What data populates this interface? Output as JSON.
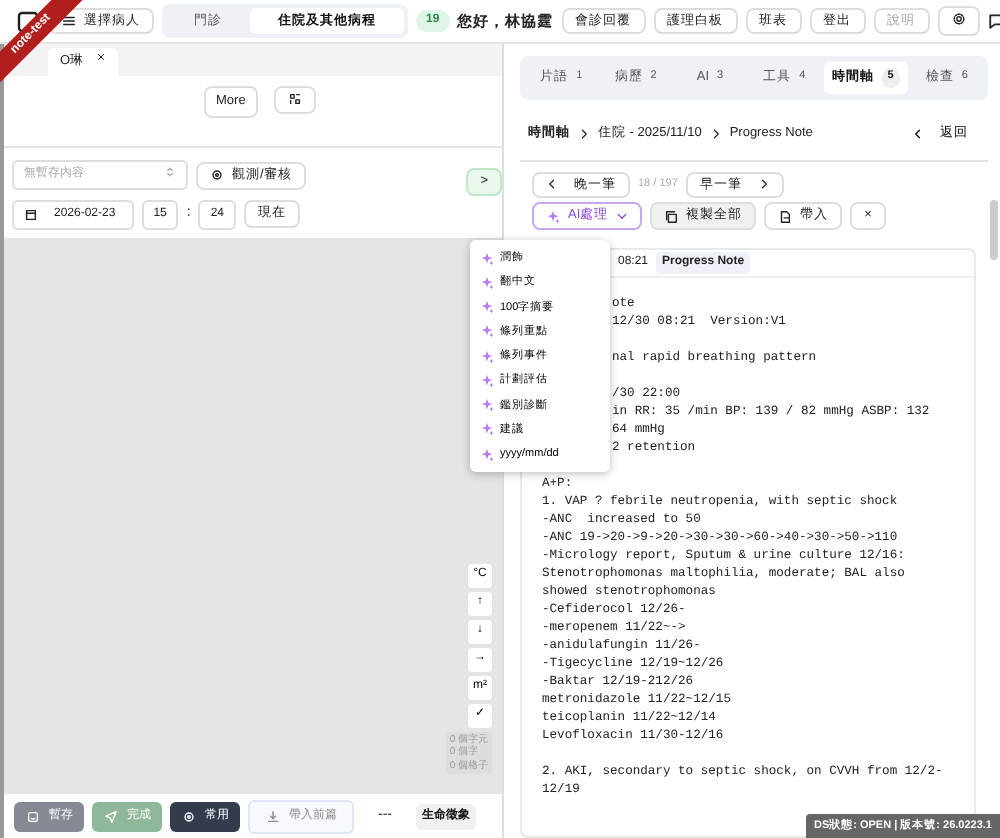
{
  "ribbon": "note-test",
  "top_bar": {
    "select_patient": "選擇病人",
    "segments": [
      {
        "label": "門診",
        "selected": false
      },
      {
        "label": "住院及其他病程",
        "selected": true
      }
    ],
    "badge": "19",
    "greeting": "您好，林協霆",
    "buttons": [
      {
        "label": "會診回覆",
        "disabled": false
      },
      {
        "label": "護理白板",
        "disabled": false
      },
      {
        "label": "班表",
        "disabled": false
      },
      {
        "label": "登出",
        "disabled": false
      },
      {
        "label": "說明",
        "disabled": true
      }
    ]
  },
  "left_pane": {
    "patient_tab": "O琳",
    "more_button": "More",
    "draft_select": {
      "value": "無暫存內容"
    },
    "observe_button": "觀測/審核",
    "expand_button": ">",
    "date": "2026-02-23",
    "hour": "15",
    "minute": "24",
    "time_separator": ":",
    "now_button": "現在",
    "symbol_buttons": [
      "°C",
      "↑",
      "↓",
      "→",
      "m²",
      "✓"
    ],
    "counters": [
      "0 個字元",
      "0 個字",
      "0 個格子"
    ],
    "footer_buttons": [
      {
        "label": "暫存",
        "kind": "save"
      },
      {
        "label": "完成",
        "kind": "done"
      },
      {
        "label": "常用",
        "kind": "common"
      },
      {
        "label": "帶入前篇",
        "kind": "import"
      }
    ],
    "separator": "---",
    "vitals_button": "生命徵象"
  },
  "right_pane": {
    "tabs": [
      {
        "label": "片語",
        "key": "1",
        "selected": false
      },
      {
        "label": "病歷",
        "key": "2",
        "selected": false
      },
      {
        "label": "AI",
        "key": "3",
        "selected": false
      },
      {
        "label": "工具",
        "key": "4",
        "selected": false
      },
      {
        "label": "時間軸",
        "key": "5",
        "selected": true
      },
      {
        "label": "檢查",
        "key": "6",
        "selected": false
      }
    ],
    "breadcrumb": [
      "時間軸",
      "住院 - 2025/11/10",
      "Progress Note"
    ],
    "back": "返回",
    "prev_button": "晚一筆",
    "position": "18 / 197",
    "next_button": "早一筆",
    "ai_button": "AI處理",
    "copy_all_button": "複製全部",
    "insert_button": "帶入",
    "close_button": "×",
    "ai_menu": [
      "潤飾",
      "翻中文",
      "100字摘要",
      "條列重點",
      "條列事件",
      "計劃評估",
      "鑑別診斷",
      "建議",
      "yyyy/mm/dd"
    ],
    "note": {
      "time": "08:21",
      "type": "Progress Note",
      "beside_menu": [
        [
          "ote",
          "12/30 08:21  Version:V1"
        ],
        [
          "nal rapid breathing pattern"
        ],
        [
          "/30 22:00",
          "in RR: 35 /min BP: 139 / 82 mmHg ASBP: 132",
          "64 mmHg",
          "2 retention"
        ]
      ],
      "paragraphs": [
        [
          "A+P:",
          "1. VAP ? febrile neutropenia, with septic shock",
          "-ANC  increased to 50",
          "-ANC 19->20->9->20->30->30->60->40->30->50->110",
          "-Micrology report, Sputum & urine culture 12/16:",
          "Stenotrophomonas maltophilia, moderate; BAL also",
          "showed stenotrophomonas",
          "-Cefiderocol 12/26-",
          "-meropenem 11/22~->",
          "-anidulafungin 11/26-",
          "-Tigecycline 12/19~12/26",
          "-Baktar 12/19-212/26",
          "metronidazole 11/22~12/15",
          "teicoplanin 11/22~12/14",
          "Levofloxacin 11/30-12/16"
        ],
        [
          "2. AKI, secondary to septic shock, on CVVH from 12/2-",
          "12/19"
        ]
      ]
    }
  },
  "status": "DS狀態: OPEN | 版本號: 26.0223.1"
}
